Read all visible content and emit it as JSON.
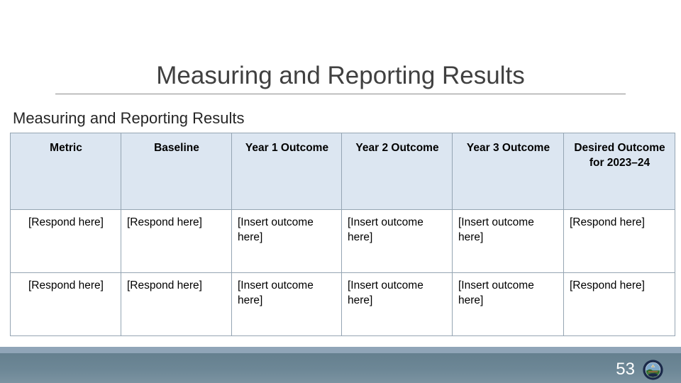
{
  "slide": {
    "title": "Measuring and Reporting Results",
    "subtitle": "Measuring and Reporting Results",
    "page_number": "53",
    "logo_name": "state-seal-logo",
    "colors": {
      "title_text": "#404040",
      "title_rule": "#8c8c8c",
      "table_header_bg": "#dce6f1",
      "table_border": "#95a5b3",
      "footer_strip": "#90a5b8",
      "footer_bar": "#6d8796",
      "page_number_text": "#ffffff"
    }
  },
  "table": {
    "headers": [
      "Metric",
      "Baseline",
      "Year 1 Outcome",
      "Year 2 Outcome",
      "Year 3 Outcome",
      "Desired Outcome for 2023–24"
    ],
    "rows": [
      [
        "[Respond here]",
        "[Respond here]",
        "[Insert outcome here]",
        "[Insert outcome here]",
        "[Insert outcome here]",
        "[Respond here]"
      ],
      [
        "[Respond here]",
        "[Respond here]",
        "[Insert outcome here]",
        "[Insert outcome here]",
        "[Insert outcome here]",
        "[Respond here]"
      ]
    ]
  }
}
